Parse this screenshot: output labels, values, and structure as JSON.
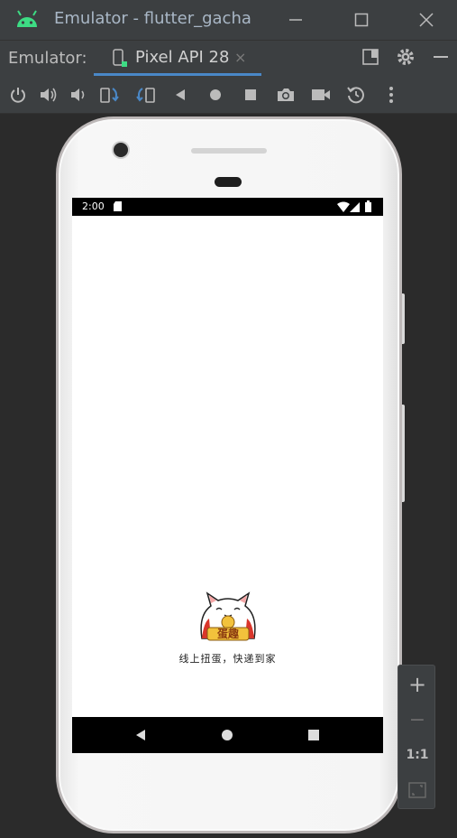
{
  "window": {
    "title": "Emulator - flutter_gacha",
    "icon": "android-icon",
    "controls": [
      "minimize-icon",
      "maximize-icon",
      "close-icon"
    ]
  },
  "tabbar": {
    "label": "Emulator:",
    "tab": {
      "name": "Pixel API 28",
      "icon": "phone-device-icon",
      "close": "×"
    }
  },
  "toolbar": {
    "buttons": [
      "power-icon",
      "volume-up-icon",
      "volume-down-icon",
      "rotate-left-icon",
      "rotate-right-icon",
      "back-icon",
      "home-icon",
      "overview-icon",
      "camera-icon",
      "record-icon",
      "snapshot-icon",
      "more-icon"
    ]
  },
  "device": {
    "statusbar": {
      "time": "2:00"
    },
    "app": {
      "tagline": "线上扭蛋，快递到家",
      "logo_text": "蛋趣"
    }
  },
  "zoom": {
    "plus": "+",
    "minus": "−",
    "one_to_one": "1:1"
  },
  "colors": {
    "accent": "#4a88c7",
    "android_green": "#3ddc84",
    "chrome": "#3c3f41",
    "background": "#2b2b2b"
  }
}
